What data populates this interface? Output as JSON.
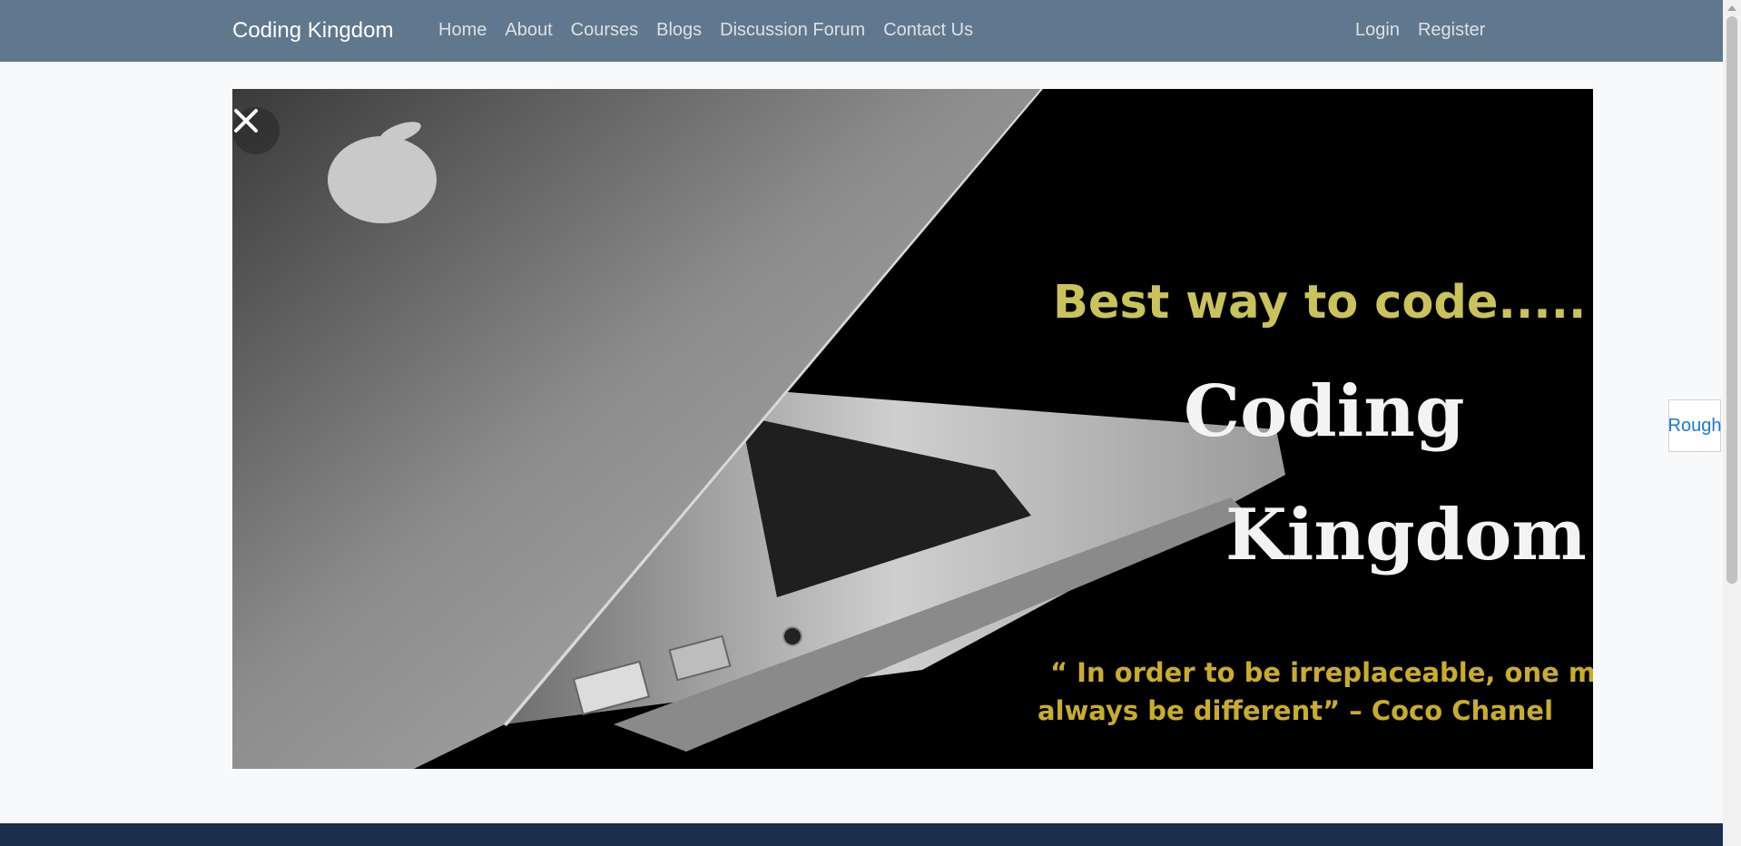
{
  "navbar": {
    "brand": "Coding Kingdom",
    "links": [
      "Home",
      "About",
      "Courses",
      "Blogs",
      "Discussion Forum",
      "Contact Us"
    ],
    "auth": [
      "Login",
      "Register"
    ],
    "background": "#5f788d"
  },
  "hero": {
    "tagline": "Best way to code.....",
    "title_line1": "Coding",
    "title_line2": "Kingdom",
    "quote_line1": "“ In order to be irreplaceable, one must",
    "quote_line2": "always be different”   – Coco Chanel",
    "close_icon": "close-icon"
  },
  "side_tab": {
    "label": "Rough"
  },
  "footer": {
    "background": "#1b2e4b"
  }
}
